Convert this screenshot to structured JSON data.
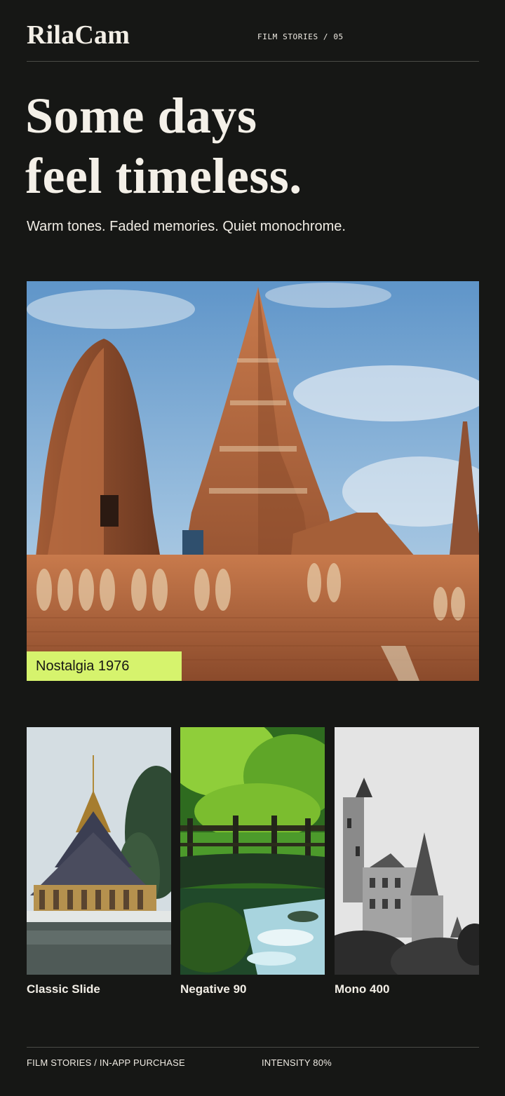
{
  "app": {
    "brand": "RilaCam",
    "issue_label": "FILM STORIES / 05"
  },
  "hero": {
    "headline_line1": "Some days",
    "headline_line2": "feel timeless.",
    "subline": "Warm tones. Faded memories. Quiet monochrome.",
    "featured_filter": "Nostalgia 1976",
    "tag_color": "#d6f36d"
  },
  "filters": [
    {
      "label": "Classic Slide"
    },
    {
      "label": "Negative 90"
    },
    {
      "label": "Mono 400"
    }
  ],
  "footer": {
    "left": "FILM STORIES  /  IN-APP PURCHASE",
    "right": "INTENSITY 80%"
  },
  "colors": {
    "background": "#161715",
    "accent": "#d6f36d",
    "text": "#f2eee6"
  }
}
